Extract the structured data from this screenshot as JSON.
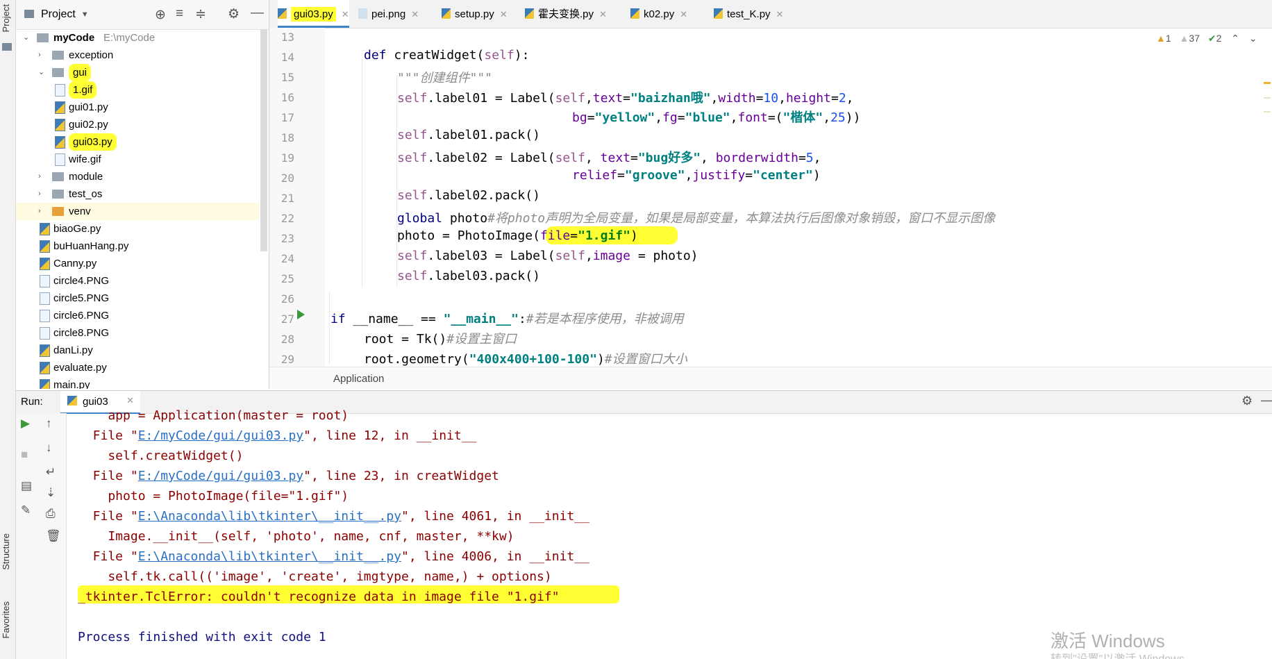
{
  "left_strip": {
    "project": "Project",
    "structure": "Structure",
    "favorites": "Favorites"
  },
  "project_panel": {
    "title": "Project",
    "tree": [
      {
        "label": "myCode",
        "suffix": "E:\\myCode",
        "type": "root",
        "depth": 0,
        "expanded": true,
        "highlight": false
      },
      {
        "label": "exception",
        "type": "folder",
        "depth": 1,
        "expanded": false,
        "highlight": false
      },
      {
        "label": "gui",
        "type": "folder",
        "depth": 1,
        "expanded": true,
        "highlight": true
      },
      {
        "label": "1.gif",
        "type": "image",
        "depth": 2,
        "highlight": true
      },
      {
        "label": "gui01.py",
        "type": "py",
        "depth": 2,
        "highlight": false
      },
      {
        "label": "gui02.py",
        "type": "py",
        "depth": 2,
        "highlight": false
      },
      {
        "label": "gui03.py",
        "type": "py",
        "depth": 2,
        "highlight": true
      },
      {
        "label": "wife.gif",
        "type": "image",
        "depth": 2,
        "highlight": false
      },
      {
        "label": "module",
        "type": "folder",
        "depth": 1,
        "expanded": false,
        "highlight": false
      },
      {
        "label": "test_os",
        "type": "folder",
        "depth": 1,
        "expanded": false,
        "highlight": false
      },
      {
        "label": "venv",
        "type": "folder-orange",
        "depth": 1,
        "expanded": false,
        "highlight": false
      },
      {
        "label": "biaoGe.py",
        "type": "py",
        "depth": 1,
        "highlight": false
      },
      {
        "label": "buHuanHang.py",
        "type": "py",
        "depth": 1,
        "highlight": false
      },
      {
        "label": "Canny.py",
        "type": "py",
        "depth": 1,
        "highlight": false
      },
      {
        "label": "circle4.PNG",
        "type": "image",
        "depth": 1,
        "highlight": false
      },
      {
        "label": "circle5.PNG",
        "type": "image",
        "depth": 1,
        "highlight": false
      },
      {
        "label": "circle6.PNG",
        "type": "image",
        "depth": 1,
        "highlight": false
      },
      {
        "label": "circle8.PNG",
        "type": "image",
        "depth": 1,
        "highlight": false
      },
      {
        "label": "danLi.py",
        "type": "py",
        "depth": 1,
        "highlight": false
      },
      {
        "label": "evaluate.py",
        "type": "py",
        "depth": 1,
        "highlight": false
      },
      {
        "label": "main.py",
        "type": "py",
        "depth": 1,
        "highlight": false
      }
    ]
  },
  "tabs": [
    {
      "label": "gui03.py",
      "active": true
    },
    {
      "label": "pei.png",
      "active": false
    },
    {
      "label": "setup.py",
      "active": false
    },
    {
      "label": "霍夫变换.py",
      "active": false
    },
    {
      "label": "k02.py",
      "active": false
    },
    {
      "label": "test_K.py",
      "active": false
    }
  ],
  "inspections": {
    "errors": "1",
    "warnings": "37",
    "ok": "2"
  },
  "line_numbers": [
    "13",
    "14",
    "15",
    "16",
    "17",
    "18",
    "19",
    "20",
    "21",
    "22",
    "23",
    "24",
    "25",
    "26",
    "27",
    "28",
    "29"
  ],
  "breadcrumb": "Application",
  "run": {
    "label": "Run:",
    "tab": "gui03",
    "output": [
      "    app = Application(master = root)",
      "  File \"E:/myCode/gui/gui03.py\", line 12, in __init__",
      "    self.creatWidget()",
      "  File \"E:/myCode/gui/gui03.py\", line 23, in creatWidget",
      "    photo = PhotoImage(file=\"1.gif\")",
      "  File \"E:\\Anaconda\\lib\\tkinter\\__init__.py\", line 4061, in __init__",
      "    Image.__init__(self, 'photo', name, cnf, master, **kw)",
      "  File \"E:\\Anaconda\\lib\\tkinter\\__init__.py\", line 4006, in __init__",
      "    self.tk.call(('image', 'create', imgtype, name,) + options)",
      "_tkinter.TclError: couldn't recognize data in image file \"1.gif\"",
      "",
      "Process finished with exit code 1"
    ]
  },
  "watermark": {
    "line1": "激活 Windows",
    "line2": "转到\"设置\"以激活 Windows"
  },
  "colors": {
    "highlight": "#ffff33",
    "accent": "#4083c9",
    "error_text": "#8b0000"
  }
}
